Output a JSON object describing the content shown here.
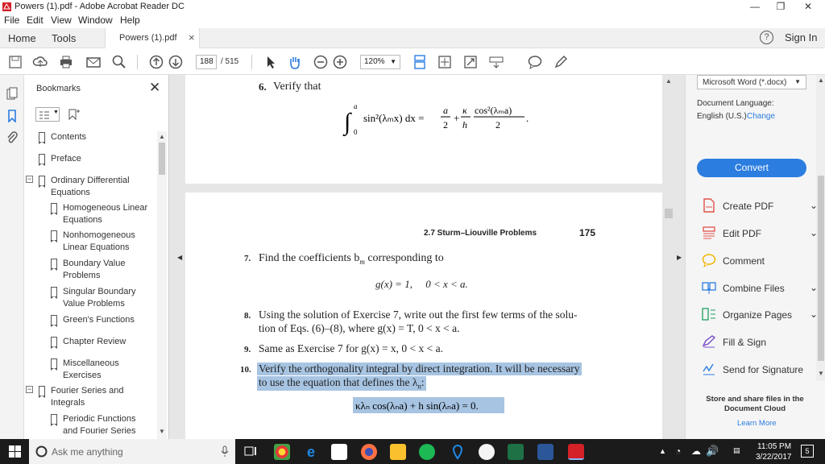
{
  "window": {
    "title": "Powers (1).pdf - Adobe Acrobat Reader DC",
    "minimize": "—",
    "restore": "❐",
    "close": "✕"
  },
  "menu": [
    "File",
    "Edit",
    "View",
    "Window",
    "Help"
  ],
  "tabs": {
    "home": "Home",
    "tools": "Tools",
    "document": "Powers (1).pdf",
    "close": "×",
    "help": "?",
    "sign_in": "Sign In"
  },
  "toolbar": {
    "page_current": "188",
    "page_total": "/ 515",
    "zoom": "120%"
  },
  "bookmarks": {
    "title": "Bookmarks",
    "items": [
      {
        "label": "Contents",
        "level": 0
      },
      {
        "label": "Preface",
        "level": 0
      },
      {
        "label": "Ordinary Differential Equations",
        "level": 0,
        "expanded": true
      },
      {
        "label": "Homogeneous Linear Equations",
        "level": 1
      },
      {
        "label": "Nonhomogeneous Linear Equations",
        "level": 1
      },
      {
        "label": "Boundary Value Problems",
        "level": 1
      },
      {
        "label": "Singular Boundary Value Problems",
        "level": 1
      },
      {
        "label": "Green's Functions",
        "level": 1
      },
      {
        "label": "Chapter Review",
        "level": 1
      },
      {
        "label": "Miscellaneous Exercises",
        "level": 1
      },
      {
        "label": "Fourier Series and Integrals",
        "level": 0,
        "expanded": true
      },
      {
        "label": "Periodic Functions and Fourier Series",
        "level": 1
      }
    ]
  },
  "document": {
    "ex6_num": "6.",
    "ex6_text": "Verify that",
    "header_section": "2.7 Sturm–Liouville Problems",
    "header_page": "175",
    "ex7_num": "7.",
    "ex7_text": "Find the coefficients b",
    "ex7_sub": "m",
    "ex7_text2": " corresponding to",
    "ex7_eq": "g(x) = 1,     0 < x < a.",
    "ex8_num": "8.",
    "ex8_line1": "Using the solution of Exercise 7, write out the first few terms of the solu-",
    "ex8_line2": "tion of Eqs. (6)–(8), where g(x) = T, 0 < x < a.",
    "ex9_num": "9.",
    "ex9_text": "Same as Exercise 7 for g(x) = x, 0 < x < a.",
    "ex10_num": "10.",
    "ex10_line1": "Verify the orthogonality integral by direct integration. It will be necessary",
    "ex10_line2": "to use the equation that defines the λ",
    "ex10_line2_sub": "n",
    "ex10_line2_end": ":"
  },
  "right_panel": {
    "format": "Microsoft Word (*.docx)",
    "doc_lang_label": "Document Language:",
    "doc_lang_value": "English (U.S.)",
    "change": "Change",
    "convert": "Convert",
    "tools": [
      "Create PDF",
      "Edit PDF",
      "Comment",
      "Combine Files",
      "Organize Pages",
      "Fill & Sign",
      "Send for Signature"
    ],
    "store_text": "Store and share files in the Document Cloud",
    "learn_more": "Learn More"
  },
  "taskbar": {
    "search": "Ask me anything",
    "time": "11:05 PM",
    "date": "3/22/2017",
    "notif_count": "5"
  },
  "colors": {
    "accent_blue": "#2b7de0",
    "highlight": "#a7c4e2",
    "acrobat_red": "#d42027"
  }
}
